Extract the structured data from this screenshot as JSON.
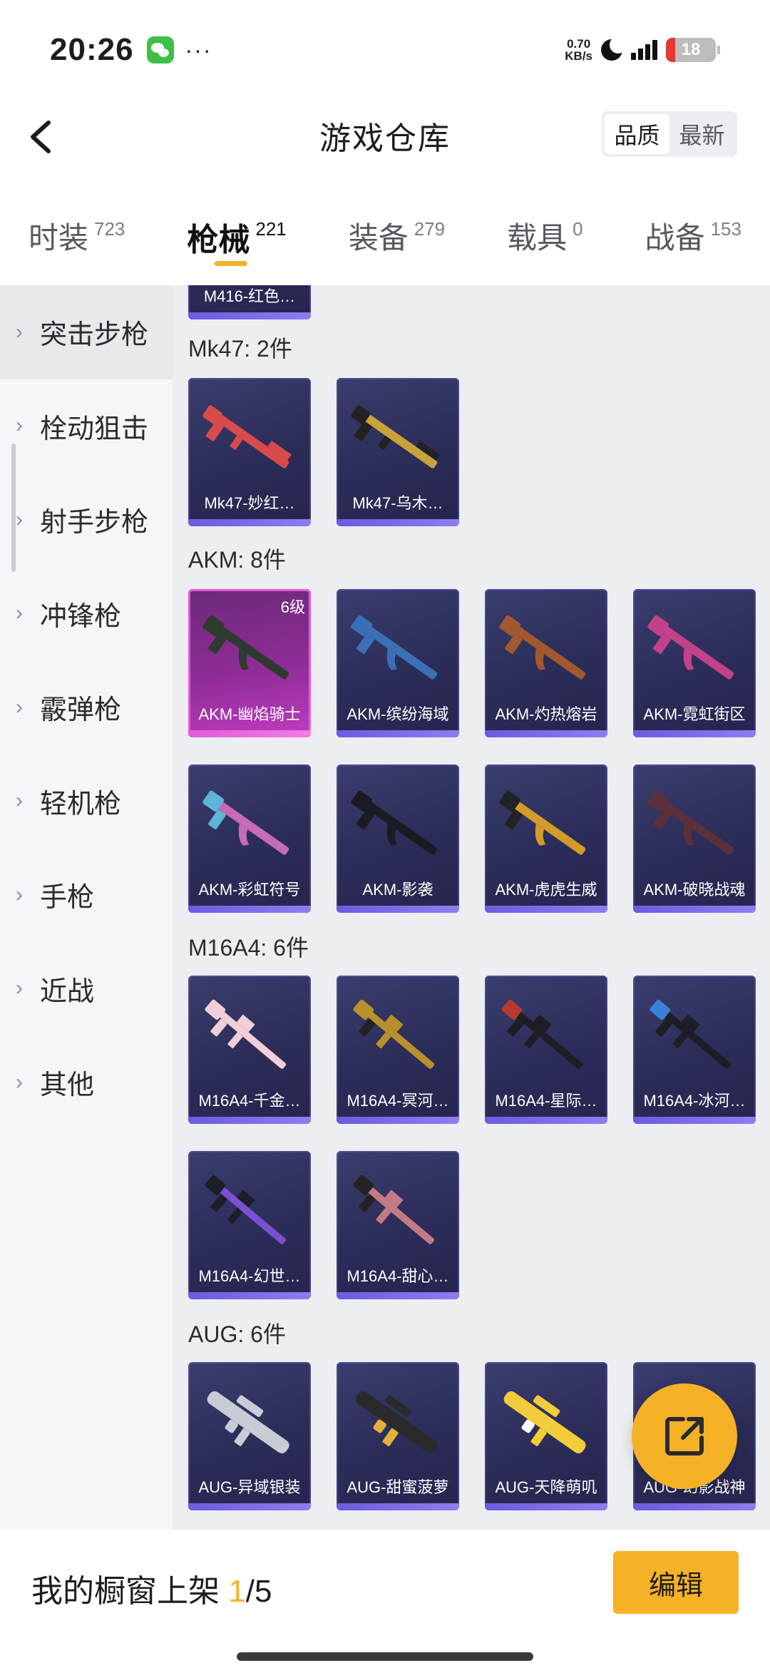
{
  "status_bar": {
    "time": "20:26",
    "more": "···",
    "net_speed_value": "0.70",
    "net_speed_unit": "KB/s",
    "battery": "18",
    "battery_level": 0.18
  },
  "header": {
    "title": "游戏仓库",
    "sort_options": [
      "品质",
      "最新"
    ],
    "active_sort": "品质"
  },
  "tabs": [
    {
      "label": "时装",
      "count": "723"
    },
    {
      "label": "枪械",
      "count": "221"
    },
    {
      "label": "装备",
      "count": "279"
    },
    {
      "label": "载具",
      "count": "0"
    },
    {
      "label": "战备",
      "count": "153"
    }
  ],
  "active_tab": "枪械",
  "sidebar": {
    "items": [
      "突击步枪",
      "栓动狙击",
      "射手步枪",
      "冲锋枪",
      "霰弹枪",
      "轻机枪",
      "手枪",
      "近战",
      "其他"
    ],
    "active": "突击步枪"
  },
  "groups": [
    {
      "title": "",
      "items": [
        {
          "name": "M416-红色…"
        }
      ]
    },
    {
      "title": "Mk47: 2件",
      "items": [
        {
          "name": "Mk47-妙红…"
        },
        {
          "name": "Mk47-乌木…"
        }
      ]
    },
    {
      "title": "AKM: 8件",
      "items": [
        {
          "name": "AKM-幽焰骑士",
          "level": "6级"
        },
        {
          "name": "AKM-缤纷海域"
        },
        {
          "name": "AKM-灼热熔岩"
        },
        {
          "name": "AKM-霓虹街区"
        },
        {
          "name": "AKM-彩虹符号"
        },
        {
          "name": "AKM-影袭"
        },
        {
          "name": "AKM-虎虎生威"
        },
        {
          "name": "AKM-破晓战魂"
        }
      ]
    },
    {
      "title": "M16A4: 6件",
      "items": [
        {
          "name": "M16A4-千金…"
        },
        {
          "name": "M16A4-冥河…"
        },
        {
          "name": "M16A4-星际…"
        },
        {
          "name": "M16A4-冰河…"
        },
        {
          "name": "M16A4-幻世…"
        },
        {
          "name": "M16A4-甜心…"
        }
      ]
    },
    {
      "title": "AUG: 6件",
      "items": [
        {
          "name": "AUG-异域银装"
        },
        {
          "name": "AUG-甜蜜菠萝"
        },
        {
          "name": "AUG-天降萌叽"
        },
        {
          "name": "AUG-幻影战神"
        }
      ]
    }
  ],
  "bottom_bar": {
    "shelf_label": "我的橱窗上架 ",
    "shelf_current": "1",
    "shelf_total": "/5",
    "edit_label": "编辑"
  },
  "colors": {
    "accent": "#f5b227",
    "card_bg": "#2b2c58",
    "legendary_card": "#c03cc0"
  }
}
